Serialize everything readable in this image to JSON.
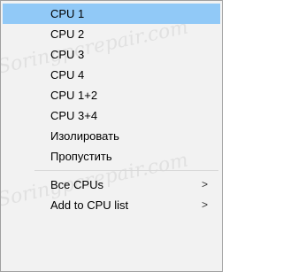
{
  "context_menu": {
    "items": [
      {
        "label": "CPU 1",
        "highlighted": true,
        "submenu": false
      },
      {
        "label": "CPU 2",
        "highlighted": false,
        "submenu": false
      },
      {
        "label": "CPU 3",
        "highlighted": false,
        "submenu": false
      },
      {
        "label": "CPU 4",
        "highlighted": false,
        "submenu": false
      },
      {
        "label": "CPU 1+2",
        "highlighted": false,
        "submenu": false
      },
      {
        "label": "CPU 3+4",
        "highlighted": false,
        "submenu": false
      },
      {
        "label": "Изолировать",
        "highlighted": false,
        "submenu": false
      },
      {
        "label": "Пропустить",
        "highlighted": false,
        "submenu": false
      },
      {
        "label": "Все CPUs",
        "highlighted": false,
        "submenu": true
      },
      {
        "label": "Add to CPU list",
        "highlighted": false,
        "submenu": true
      }
    ],
    "submenu_arrow": ">"
  },
  "watermark": {
    "text_1": "Soringpcrepair.com",
    "text_2": "Soringpcrepair.com"
  },
  "colors": {
    "menu_background": "#f2f2f2",
    "highlight": "#91c9f7",
    "border": "#a0a0a0",
    "separator": "#d7d7d7"
  }
}
